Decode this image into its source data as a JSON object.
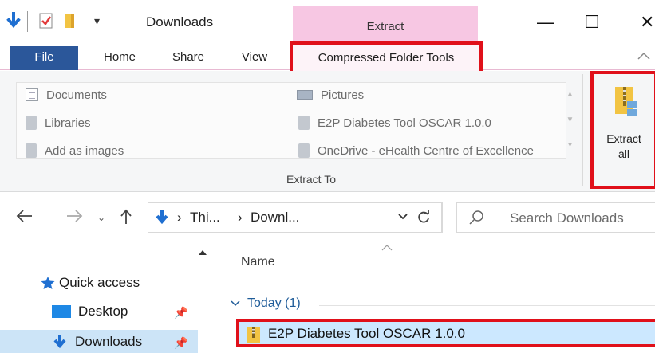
{
  "titlebar": {
    "title": "Downloads",
    "context_tab_label": "Extract",
    "minimize_glyph": "—",
    "maximize_glyph": "☐",
    "close_glyph": "✕"
  },
  "tabs": {
    "file": "File",
    "home": "Home",
    "share": "Share",
    "view": "View",
    "compressed": "Compressed Folder Tools",
    "collapse_glyph": "^"
  },
  "ribbon": {
    "destinations_col1": [
      "Documents",
      "Libraries",
      "Add as images"
    ],
    "destinations_col2": [
      "Pictures",
      "E2P Diabetes Tool OSCAR 1.0.0",
      "OneDrive - eHealth Centre of Excellence"
    ],
    "group_label": "Extract To",
    "extract_all_line1": "Extract",
    "extract_all_line2": "all"
  },
  "address": {
    "crumb1": "Thi...",
    "crumb2": "Downl...",
    "search_placeholder": "Search Downloads"
  },
  "nav": {
    "quick_access": "Quick access",
    "desktop": "Desktop",
    "downloads": "Downloads"
  },
  "content": {
    "column_name": "Name",
    "group_today": "Today (1)",
    "file_name": "E2P Diabetes Tool OSCAR 1.0.0"
  },
  "colors": {
    "highlight_red": "#e0101a",
    "extract_context_pink": "#f7c7e3",
    "file_tab_blue": "#2b579a",
    "selection_blue": "#cce8ff"
  }
}
